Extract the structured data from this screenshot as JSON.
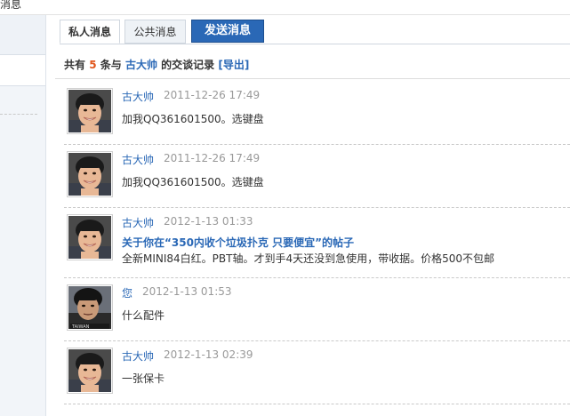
{
  "topbar": {
    "text": "消息"
  },
  "tabs": {
    "private": "私人消息",
    "public": "公共消息",
    "send": "发送消息"
  },
  "summary": {
    "prefix": "共有",
    "count": "5",
    "mid": "条与",
    "user": "古大帅",
    "suffix": "的交谈记录",
    "export": "[导出]"
  },
  "messages": [
    {
      "author": "古大帅",
      "time": "2011-12-26 17:49",
      "text": "加我QQ361601500。选键盘",
      "avatar": "boy-avatar"
    },
    {
      "author": "古大帅",
      "time": "2011-12-26 17:49",
      "text": "加我QQ361601500。选键盘",
      "avatar": "boy-avatar"
    },
    {
      "author": "古大帅",
      "time": "2012-1-13 01:33",
      "title": "关于你在“350内收个垃圾扑克 只要便宜”的帖子",
      "text": "全新MINI84白红。PBT轴。才到手4天还没到急使用，带收据。价格500不包邮",
      "avatar": "boy-avatar"
    },
    {
      "author": "您",
      "time": "2012-1-13 01:53",
      "text": "什么配件",
      "avatar": "man-avatar"
    },
    {
      "author": "古大帅",
      "time": "2012-1-13 02:39",
      "text": "一张保卡",
      "avatar": "boy-avatar"
    }
  ]
}
